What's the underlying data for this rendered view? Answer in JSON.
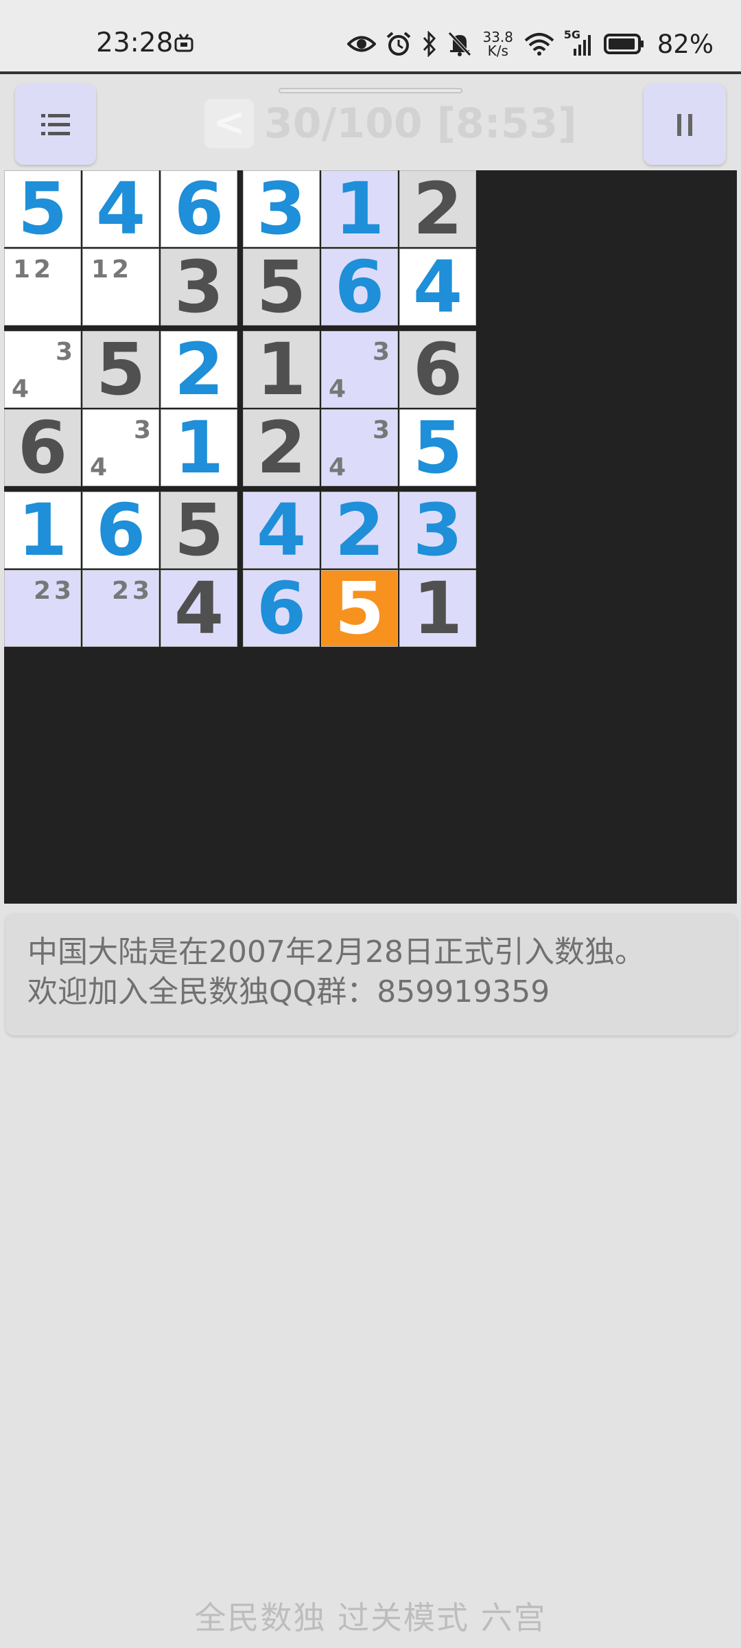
{
  "status_bar": {
    "time": "23:28",
    "net_speed_value": "33.8",
    "net_speed_unit": "K/s",
    "network_type": "5G",
    "battery": "82%",
    "icons": [
      "tv-icon",
      "eye-icon",
      "alarm-icon",
      "bluetooth-icon",
      "bell-muted-icon",
      "wifi-icon",
      "signal-icon",
      "battery-icon"
    ]
  },
  "toolbar": {
    "back_label": "<",
    "level_timer": "30/100 [8:53]",
    "menu_icon": "list-icon",
    "pause_icon": "pause-icon"
  },
  "board": {
    "size": 6,
    "colors": {
      "given": "#505050",
      "entered": "#1e8fd8",
      "selected_text": "#ffffff",
      "white": "#ffffff",
      "gray": "#dcdcdc",
      "highlight": "#dcdcfa",
      "selected": "#f7921e",
      "note": "#777777"
    },
    "cells": [
      [
        {
          "v": "5",
          "t": "entered",
          "bg": "white"
        },
        {
          "v": "4",
          "t": "entered",
          "bg": "white"
        },
        {
          "v": "6",
          "t": "entered",
          "bg": "white"
        },
        {
          "v": "3",
          "t": "entered",
          "bg": "white"
        },
        {
          "v": "1",
          "t": "entered",
          "bg": "highlight"
        },
        {
          "v": "2",
          "t": "given",
          "bg": "gray"
        }
      ],
      [
        {
          "v": "",
          "bg": "white",
          "notes": [
            "1",
            "2"
          ]
        },
        {
          "v": "",
          "bg": "white",
          "notes": [
            "1",
            "2"
          ]
        },
        {
          "v": "3",
          "t": "given",
          "bg": "gray"
        },
        {
          "v": "5",
          "t": "given",
          "bg": "gray"
        },
        {
          "v": "6",
          "t": "entered",
          "bg": "highlight"
        },
        {
          "v": "4",
          "t": "entered",
          "bg": "white"
        }
      ],
      [
        {
          "v": "",
          "bg": "white",
          "notes": [
            "3",
            "4"
          ]
        },
        {
          "v": "5",
          "t": "given",
          "bg": "gray"
        },
        {
          "v": "2",
          "t": "entered",
          "bg": "white"
        },
        {
          "v": "1",
          "t": "given",
          "bg": "gray"
        },
        {
          "v": "",
          "bg": "highlight",
          "notes": [
            "3",
            "4"
          ]
        },
        {
          "v": "6",
          "t": "given",
          "bg": "gray"
        }
      ],
      [
        {
          "v": "6",
          "t": "given",
          "bg": "gray"
        },
        {
          "v": "",
          "bg": "white",
          "notes": [
            "3",
            "4"
          ]
        },
        {
          "v": "1",
          "t": "entered",
          "bg": "white"
        },
        {
          "v": "2",
          "t": "given",
          "bg": "gray"
        },
        {
          "v": "",
          "bg": "highlight",
          "notes": [
            "3",
            "4"
          ]
        },
        {
          "v": "5",
          "t": "entered",
          "bg": "white"
        }
      ],
      [
        {
          "v": "1",
          "t": "entered",
          "bg": "white"
        },
        {
          "v": "6",
          "t": "entered",
          "bg": "white"
        },
        {
          "v": "5",
          "t": "given",
          "bg": "gray"
        },
        {
          "v": "4",
          "t": "entered",
          "bg": "highlight"
        },
        {
          "v": "2",
          "t": "entered",
          "bg": "highlight"
        },
        {
          "v": "3",
          "t": "entered",
          "bg": "highlight"
        }
      ],
      [
        {
          "v": "",
          "bg": "highlight",
          "notes": [
            "2",
            "3"
          ]
        },
        {
          "v": "",
          "bg": "highlight",
          "notes": [
            "2",
            "3"
          ]
        },
        {
          "v": "4",
          "t": "given",
          "bg": "highlight"
        },
        {
          "v": "6",
          "t": "entered",
          "bg": "highlight"
        },
        {
          "v": "5",
          "t": "selected",
          "bg": "selected"
        },
        {
          "v": "1",
          "t": "given",
          "bg": "highlight"
        }
      ]
    ]
  },
  "tip": {
    "line1": "中国大陆是在2007年2月28日正式引入数独。",
    "line2": "欢迎加入全民数独QQ群：859919359"
  },
  "footer": {
    "title": "全民数独 过关模式 六宫"
  }
}
